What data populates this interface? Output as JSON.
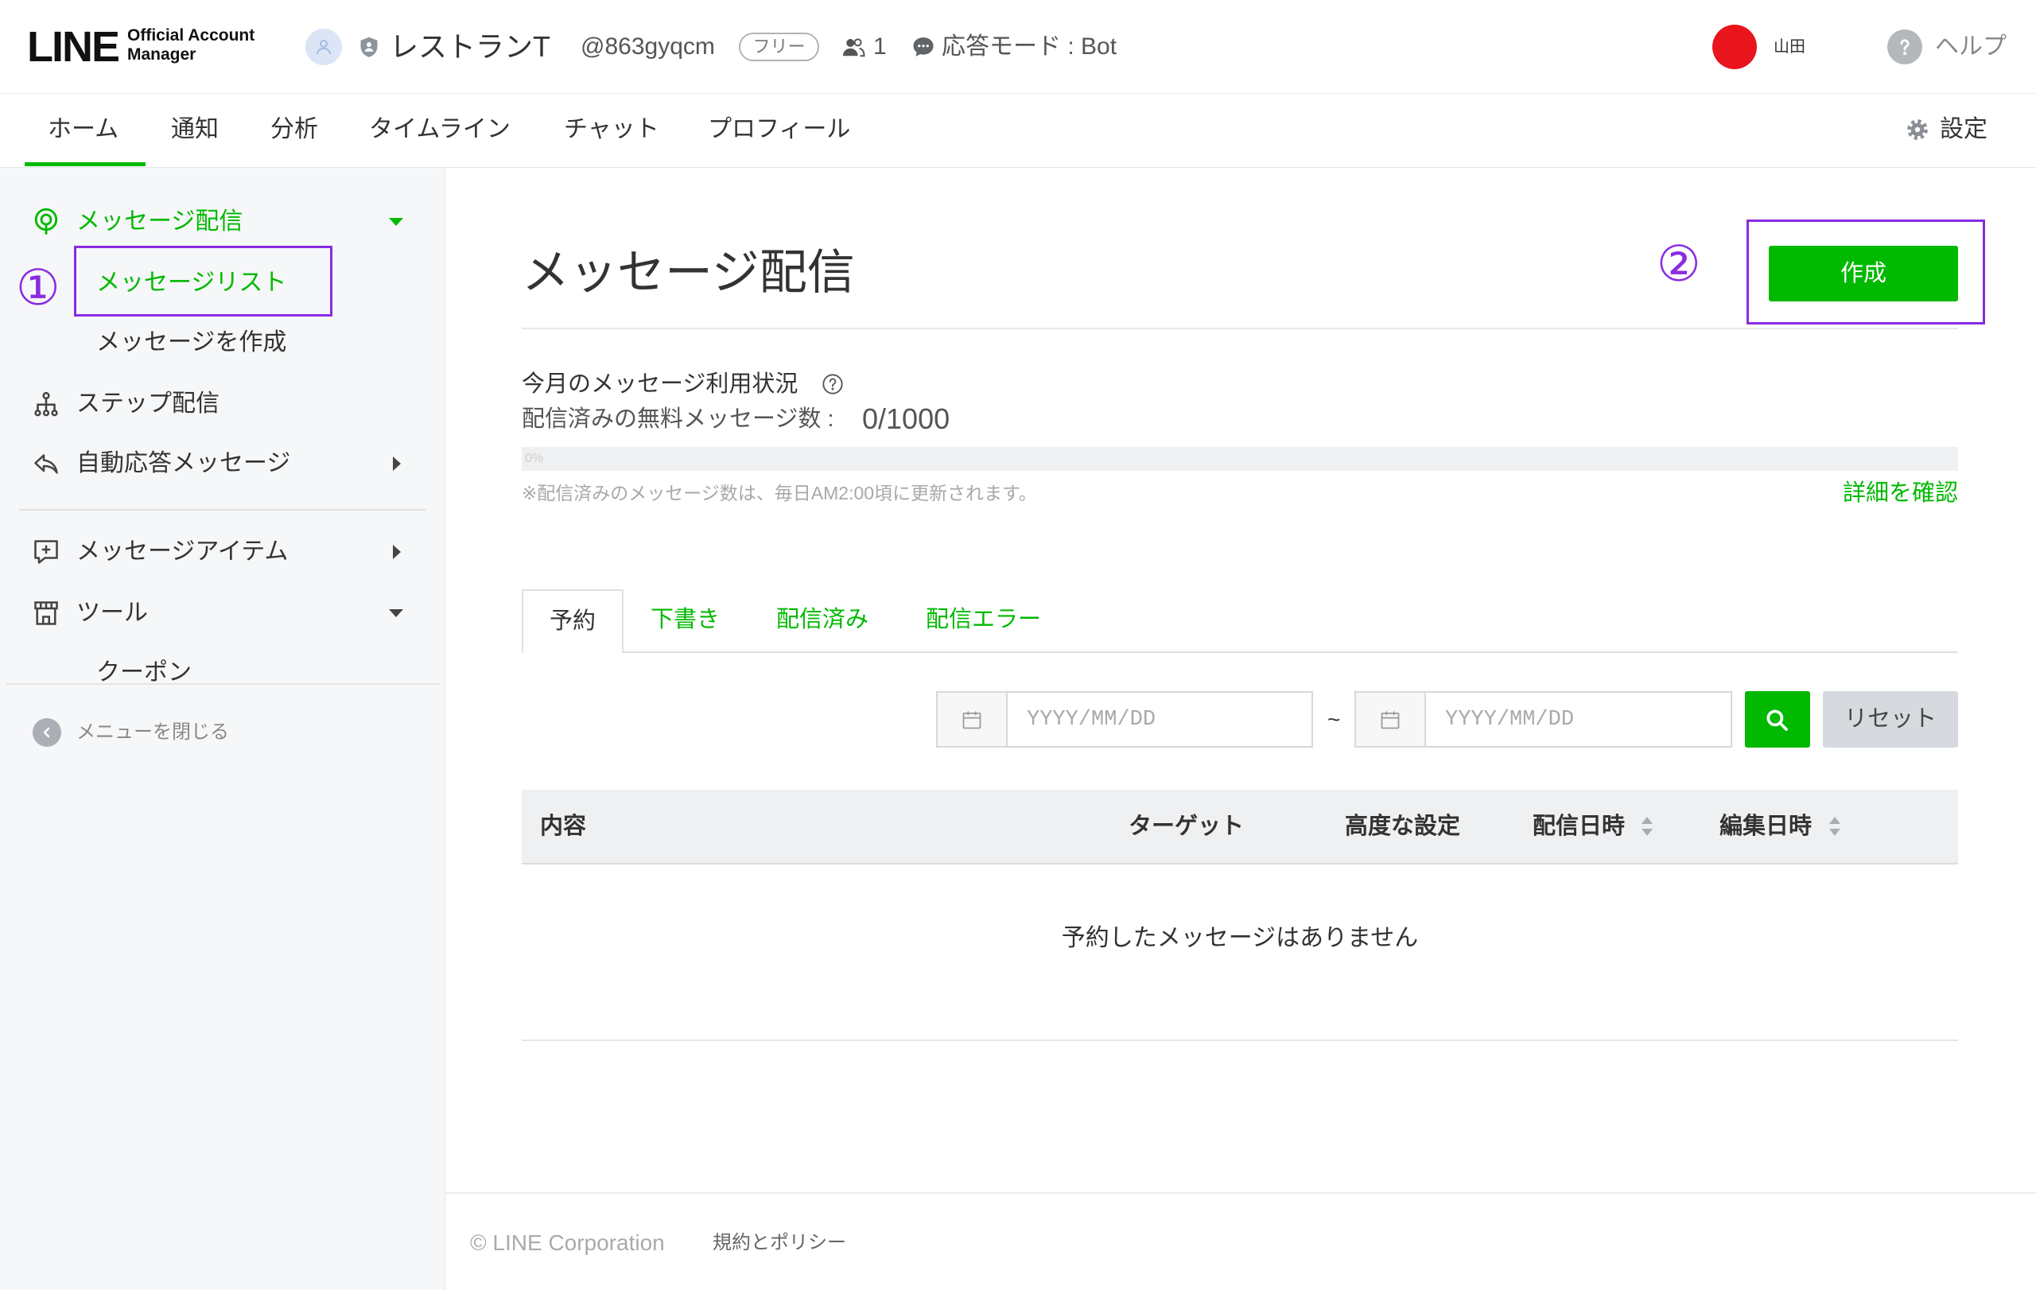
{
  "header": {
    "logo": {
      "main": "LINE",
      "line1": "Official Account",
      "line2": "Manager"
    },
    "account": {
      "avatar_icon": "account-avatar-icon",
      "verified_icon": "shield-icon",
      "name": "レストランT",
      "id": "@863gyqcm",
      "plan": "フリー",
      "friends_icon": "people-icon",
      "friends": "1",
      "mode_icon": "chat-bubble-icon",
      "response_mode": "応答モード : Bot"
    },
    "user": {
      "name": "山田",
      "avatar_color": "#e8161c"
    },
    "help": {
      "icon": "help-icon",
      "label": "ヘルプ"
    }
  },
  "nav": {
    "tabs": [
      {
        "label": "ホーム",
        "active": true
      },
      {
        "label": "通知"
      },
      {
        "label": "分析"
      },
      {
        "label": "タイムライン"
      },
      {
        "label": "チャット"
      },
      {
        "label": "プロフィール"
      }
    ],
    "settings": {
      "icon": "gear-icon",
      "label": "設定"
    }
  },
  "sidebar": {
    "items": [
      {
        "label": "メッセージ配信",
        "icon": "broadcast-icon",
        "expanded": true,
        "active": true,
        "children": [
          {
            "label": "メッセージリスト",
            "active": true
          },
          {
            "label": "メッセージを作成"
          }
        ]
      },
      {
        "label": "ステップ配信",
        "icon": "step-hierarchy-icon"
      },
      {
        "label": "自動応答メッセージ",
        "icon": "reply-icon",
        "expandable": true
      },
      {
        "label": "メッセージアイテム",
        "icon": "message-item-icon",
        "expandable": true
      },
      {
        "label": "ツール",
        "icon": "store-icon",
        "expanded": true,
        "children": [
          {
            "label": "クーポン"
          }
        ]
      }
    ],
    "close_menu": {
      "icon": "chevron-left-icon",
      "label": "メニューを閉じる"
    }
  },
  "annotations": {
    "marker1": "①",
    "marker2": "②",
    "color": "#8a2be2"
  },
  "main": {
    "title": "メッセージ配信",
    "create_button": "作成",
    "usage": {
      "heading": "今月のメッセージ利用状況",
      "count_label": "配信済みの無料メッセージ数 :",
      "count_value": "0/1000",
      "progress_label": "0%",
      "progress_value": 0,
      "note": "※配信済みのメッセージ数は、毎日AM2:00頃に更新されます。",
      "details_link": "詳細を確認"
    },
    "tabs": [
      {
        "label": "予約",
        "active": true
      },
      {
        "label": "下書き"
      },
      {
        "label": "配信済み"
      },
      {
        "label": "配信エラー"
      }
    ],
    "filter": {
      "start_placeholder": "YYYY/MM/DD",
      "separator": "~",
      "end_placeholder": "YYYY/MM/DD",
      "search_icon": "search-icon",
      "reset_label": "リセット"
    },
    "table": {
      "columns": [
        {
          "label": "内容"
        },
        {
          "label": "ターゲット"
        },
        {
          "label": "高度な設定"
        },
        {
          "label": "配信日時",
          "sortable": true
        },
        {
          "label": "編集日時",
          "sortable": true
        }
      ],
      "empty_message": "予約したメッセージはありません"
    }
  },
  "footer": {
    "copyright": "© LINE Corporation",
    "terms_link": "規約とポリシー"
  },
  "colors": {
    "brand_green": "#00b900",
    "annotation_purple": "#8a2be2",
    "text": "#333333",
    "muted_text": "#a8a8a8",
    "reset_button_bg": "#d6dadf",
    "table_header_bg": "#eef0f2"
  }
}
